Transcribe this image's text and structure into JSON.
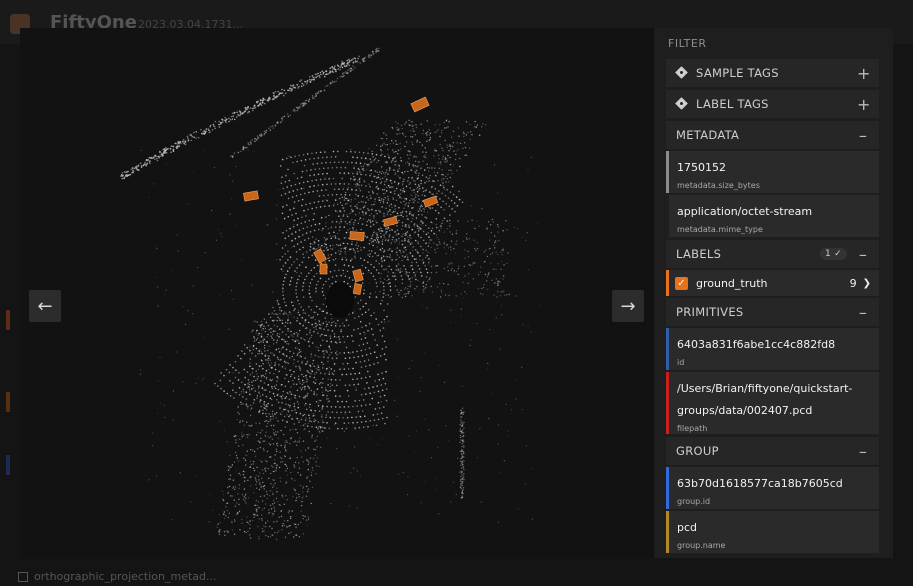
{
  "background": {
    "app_title": "FiftyOne",
    "dataset_name": "2023.03.04.1731...",
    "footer_label": "orthographic_projection_metad..."
  },
  "viewer": {
    "prev_icon": "arrow-left-icon",
    "next_icon": "arrow-right-icon"
  },
  "sidebar": {
    "filter_title": "FILTER",
    "sample_tags": {
      "label": "SAMPLE TAGS",
      "action": "+"
    },
    "label_tags": {
      "label": "LABEL TAGS",
      "action": "+"
    },
    "metadata": {
      "label": "METADATA",
      "action": "–",
      "fields": [
        {
          "value": "1750152",
          "key": "metadata.size_bytes",
          "color": "#8c8c8c"
        },
        {
          "value": "application/octet-stream",
          "key": "metadata.mime_type",
          "color": "#1f1f1f"
        }
      ]
    },
    "labels": {
      "label": "LABELS",
      "badge": "1 ✓",
      "action": "–",
      "ground_truth": {
        "name": "ground_truth",
        "count": "9",
        "color": "#e8711c"
      }
    },
    "primitives": {
      "label": "PRIMITIVES",
      "action": "–",
      "fields": [
        {
          "value": "6403a831f6abe1cc4c882fd8",
          "key": "id",
          "color": "#2f5fa8"
        },
        {
          "value_line1": "/Users/Brian/fiftyone/quickstart-",
          "value_line2": "groups/data/002407.pcd",
          "key": "filepath",
          "color": "#c8201e"
        }
      ]
    },
    "group": {
      "label": "GROUP",
      "action": "–",
      "fields": [
        {
          "value": "63b70d1618577ca18b7605cd",
          "key": "group.id",
          "color": "#2f6be0"
        },
        {
          "value": "pcd",
          "key": "group.name",
          "color": "#b08a2a"
        }
      ]
    }
  }
}
